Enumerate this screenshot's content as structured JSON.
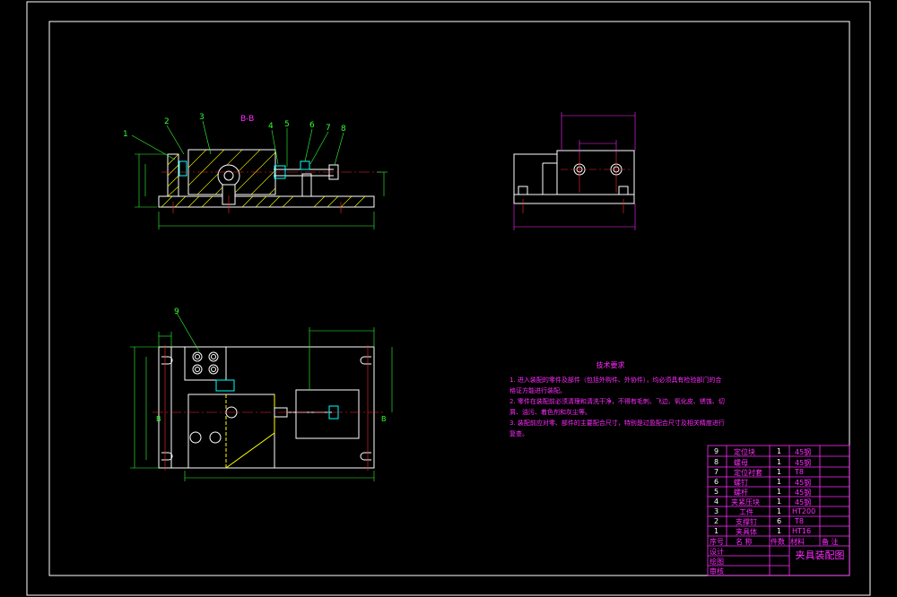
{
  "drawing": {
    "section_label": "B-B",
    "part_callouts_front": [
      "1",
      "2",
      "3",
      "4",
      "5",
      "6",
      "7",
      "8"
    ],
    "part_callout_top": "9",
    "view_marker_left": "B",
    "view_marker_right": "B"
  },
  "tech_notes": {
    "title": "技术要求",
    "lines": [
      "1. 进入装配的零件及部件（包括外购件、外协件），均必须具有检验部门的合",
      "格证方能进行装配。",
      "2. 零件在装配前必须清理和清洗干净，不得有毛刺、飞边、氧化皮、锈蚀、切",
      "屑、油污、着色剂和灰尘等。",
      "3. 装配前应对零、部件的主要配合尺寸，特别是过盈配合尺寸及相关精度进行",
      "复查。"
    ]
  },
  "title_block": {
    "rows": [
      {
        "no": "9",
        "name": "定位块",
        "qty": "1",
        "material": "45钢"
      },
      {
        "no": "8",
        "name": "螺母",
        "qty": "1",
        "material": "45钢"
      },
      {
        "no": "7",
        "name": "定位衬套",
        "qty": "1",
        "material": "T8"
      },
      {
        "no": "6",
        "name": "螺钉",
        "qty": "1",
        "material": "45钢"
      },
      {
        "no": "5",
        "name": "螺杆",
        "qty": "1",
        "material": "45钢"
      },
      {
        "no": "4",
        "name": "夹紧压块",
        "qty": "1",
        "material": "45钢"
      },
      {
        "no": "3",
        "name": "工件",
        "qty": "1",
        "material": "HT200"
      },
      {
        "no": "2",
        "name": "支撑钉",
        "qty": "6",
        "material": "T8"
      },
      {
        "no": "1",
        "name": "夹具体",
        "qty": "1",
        "material": "HT16"
      }
    ],
    "header": {
      "no": "序号",
      "name": "名  称",
      "qty": "件数",
      "material": "材料",
      "remark": "备  注"
    },
    "design_label": "设计",
    "check_label": "绘图",
    "review_label": "审核",
    "drawing_title": "夹具装配图"
  }
}
